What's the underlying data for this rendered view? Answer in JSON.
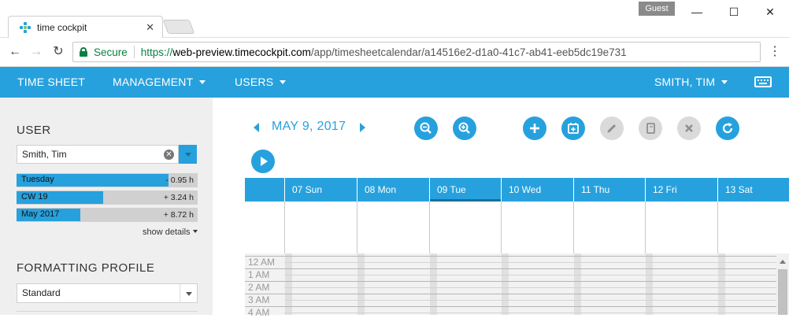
{
  "browser": {
    "tab_title": "time cockpit",
    "guest_label": "Guest",
    "secure_label": "Secure",
    "url_scheme": "https://",
    "url_host": "web-preview.timecockpit.com",
    "url_path": "/app/timesheetcalendar/a14516e2-d1a0-41c7-ab41-eeb5dc19e731"
  },
  "nav": {
    "time_sheet": "TIME SHEET",
    "management": "MANAGEMENT",
    "users": "USERS",
    "current_user": "SMITH, TIM"
  },
  "sidebar": {
    "user_title": "USER",
    "user_value": "Smith, Tim",
    "balances": [
      {
        "label": "Tuesday",
        "value": "- 0.95 h",
        "fill": 0.84
      },
      {
        "label": "CW 19",
        "value": "+ 3.24 h",
        "fill": 0.48
      },
      {
        "label": "May 2017",
        "value": "+ 8.72 h",
        "fill": 0.35
      }
    ],
    "show_details": "show details",
    "formatting_title": "FORMATTING PROFILE",
    "formatting_value": "Standard"
  },
  "calendar": {
    "date_label": "MAY 9, 2017",
    "days": [
      "07 Sun",
      "08 Mon",
      "09 Tue",
      "10 Wed",
      "11 Thu",
      "12 Fri",
      "13 Sat"
    ],
    "today_index": 2,
    "hours": [
      "12 AM",
      "1 AM",
      "2 AM",
      "3 AM",
      "4 AM"
    ]
  },
  "colors": {
    "accent": "#27a1dd",
    "accent_dark": "#1b6e99",
    "disabled": "#dadada"
  }
}
